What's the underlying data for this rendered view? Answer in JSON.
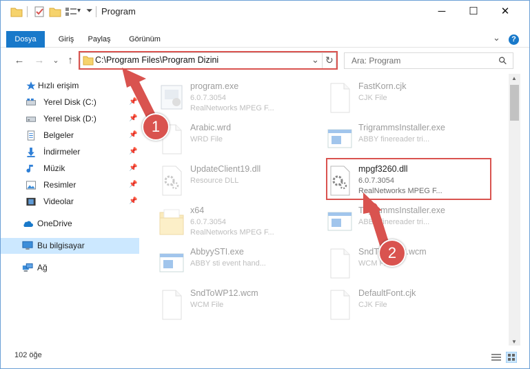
{
  "window": {
    "title": "Program",
    "minimize_glyph": "─",
    "maximize_glyph": "☐",
    "close_glyph": "✕"
  },
  "ribbon": {
    "tabs": [
      "Dosya",
      "Giriş",
      "Paylaş",
      "Görünüm"
    ],
    "expand_glyph": "⌄",
    "help_glyph": "?"
  },
  "address": {
    "path": "C:\\Program Files\\Program Dizini",
    "dropdown_glyph": "⌄",
    "refresh_glyph": "↻"
  },
  "search": {
    "placeholder": "Ara: Program",
    "icon_glyph": "⚲"
  },
  "nav": {
    "back": "←",
    "forward": "→",
    "recent": "⌄",
    "up": "↑",
    "items": [
      {
        "label": "Hızlı erişim"
      },
      {
        "label": "Yerel Disk (C:)"
      },
      {
        "label": "Yerel Disk (D:)"
      },
      {
        "label": "Belgeler"
      },
      {
        "label": "İndirmeler"
      },
      {
        "label": "Müzik"
      },
      {
        "label": "Resimler"
      },
      {
        "label": "Videolar"
      },
      {
        "label": "OneDrive"
      },
      {
        "label": "Bu bilgisayar"
      },
      {
        "label": "Ağ"
      }
    ]
  },
  "files": [
    {
      "name": "program.exe",
      "line2": "6.0.7.3054",
      "line3": "RealNetworks MPEG F...",
      "icon": "exe-icon"
    },
    {
      "name": "FastKorn.cjk",
      "line2": "CJK File",
      "line3": "",
      "icon": "doc-icon"
    },
    {
      "name": "Arabic.wrd",
      "line2": "WRD File",
      "line3": "",
      "icon": "doc-icon"
    },
    {
      "name": "TrigrammsInstaller.exe",
      "line2": "ABBY finereader tri...",
      "line3": "",
      "icon": "app-icon"
    },
    {
      "name": "UpdateClient19.dll",
      "line2": "Resource DLL",
      "line3": "",
      "icon": "dll-icon"
    },
    {
      "name": "mpgf3260.dll",
      "line2": "6.0.7.3054",
      "line3": "RealNetworks MPEG F...",
      "icon": "dll-icon"
    },
    {
      "name": "x64",
      "line2": "6.0.7.3054",
      "line3": "RealNetworks MPEG F...",
      "icon": "folder-icon"
    },
    {
      "name": "TrigrammsInstaller.exe",
      "line2": "ABBY finereader tri...",
      "line3": "",
      "icon": "app-icon"
    },
    {
      "name": "AbbyySTI.exe",
      "line2": "ABBY sti event hand...",
      "line3": "",
      "icon": "app-icon"
    },
    {
      "name": "SndToWP12.wcm",
      "line2": "WCM File",
      "line3": "",
      "icon": "doc-icon"
    },
    {
      "name": "SndToWP12.wcm",
      "line2": "WCM File",
      "line3": "",
      "icon": "doc-icon"
    },
    {
      "name": "DefaultFont.cjk",
      "line2": "CJK File",
      "line3": "",
      "icon": "doc-icon"
    }
  ],
  "status": {
    "count": "102 öğe"
  },
  "annotations": [
    {
      "number": "1",
      "color": "#d9534f"
    },
    {
      "number": "2",
      "color": "#d9534f"
    }
  ]
}
